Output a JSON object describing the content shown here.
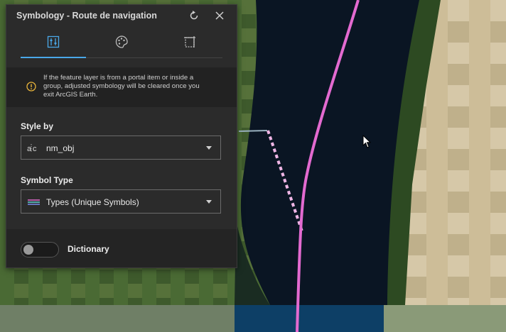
{
  "panel": {
    "title": "Symbology - Route de navigation",
    "tabs": [
      {
        "name": "style-tab",
        "icon": "sliders-icon",
        "active": true
      },
      {
        "name": "palette-tab",
        "icon": "palette-icon",
        "active": false
      },
      {
        "name": "label-tab",
        "icon": "frame-icon",
        "active": false
      }
    ],
    "notice": "If the feature layer is from a portal item or inside a group, adjusted symbology will be cleared once you exit ArcGIS Earth.",
    "style_by": {
      "label": "Style by",
      "value": "nm_obj",
      "icon": "text-field-icon"
    },
    "symbol_type": {
      "label": "Symbol Type",
      "value": "Types (Unique Symbols)",
      "icon": "unique-symbols-icon"
    },
    "dictionary": {
      "label": "Dictionary",
      "enabled": false
    }
  },
  "colors": {
    "panel_bg": "#2b2b2b",
    "accent": "#4aa8e8",
    "warning": "#e8b33a",
    "route": "#e36ad0",
    "water": "#0a1523"
  }
}
